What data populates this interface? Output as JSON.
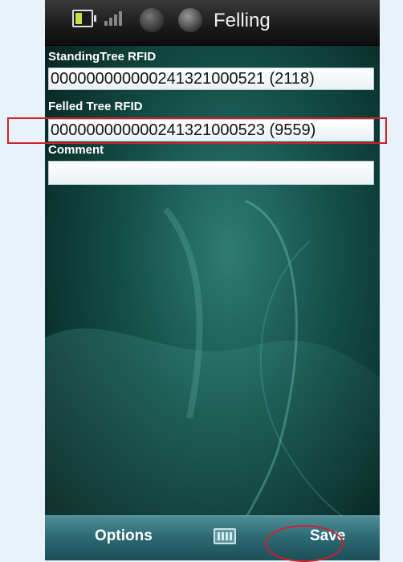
{
  "statusbar": {
    "title": "Felling",
    "icons": [
      "battery-icon",
      "signal-icon",
      "sync-icon",
      "connection-icon"
    ]
  },
  "form": {
    "standing_label": "StandingTree RFID",
    "standing_value": "000000000000241321000521 (2118)",
    "felled_label": "Felled Tree RFID",
    "felled_value": "000000000000241321000523 (9559)",
    "comment_label": "Comment",
    "comment_value": ""
  },
  "softkeys": {
    "left_label": "Options",
    "right_label": "Save",
    "middle_icon": "keyboard-icon"
  },
  "colors": {
    "annotation": "#d21f2a",
    "softkey_bar": "#2d6a74",
    "wallpaper": "#0b2a28"
  }
}
